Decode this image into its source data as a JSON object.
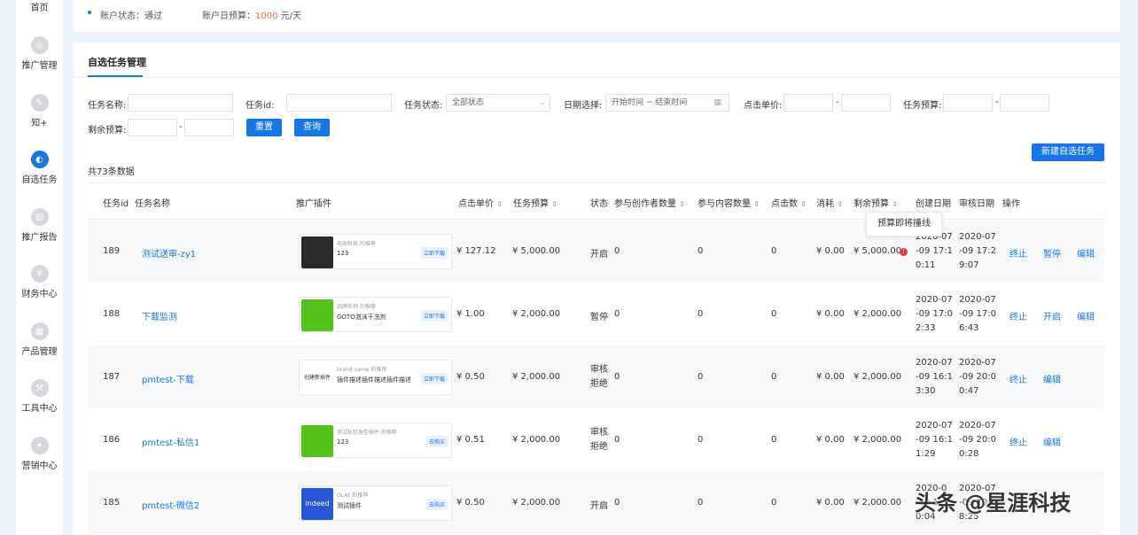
{
  "sidebar": {
    "items": [
      {
        "label": "首页",
        "icon": "home-icon"
      },
      {
        "label": "推广管理",
        "icon": "promotion-icon"
      },
      {
        "label": "知+",
        "icon": "pen-icon"
      },
      {
        "label": "自选任务",
        "icon": "task-icon"
      },
      {
        "label": "推广报告",
        "icon": "report-icon"
      },
      {
        "label": "财务中心",
        "icon": "yen-icon"
      },
      {
        "label": "产品管理",
        "icon": "product-icon"
      },
      {
        "label": "工具中心",
        "icon": "tool-icon"
      },
      {
        "label": "营销中心",
        "icon": "marketing-icon"
      }
    ]
  },
  "account": {
    "status_label": "账户状态：通过",
    "daily_budget_label": "账户日预算：",
    "daily_budget_value": "1000",
    "daily_budget_unit": " 元/天"
  },
  "tab": {
    "label": "自选任务管理"
  },
  "filters": {
    "task_name_label": "任务名称:",
    "task_id_label": "任务id:",
    "task_status_label": "任务状态:",
    "task_status_value": "全部状态",
    "date_label": "日期选择:",
    "date_placeholder": "开始时间 ~ 结束时间",
    "unit_price_label": "点击单价:",
    "budget_label": "任务预算:",
    "remaining_label": "剩余预算:",
    "dash": "-",
    "reset": "重置",
    "query": "查询",
    "new_task": "新建自选任务"
  },
  "count": "共73条数据",
  "table": {
    "headers": {
      "id": "任务id",
      "name": "任务名称",
      "plugin": "推广插件",
      "price": "点击单价",
      "budget": "任务预算",
      "status": "状态",
      "creators": "参与创作者数量",
      "contents": "参与内容数量",
      "clicks": "点击数",
      "cost": "消耗",
      "remaining": "剩余预算",
      "created": "创建日期",
      "reviewed": "审核日期",
      "ops": "操作"
    },
    "tooltip": "预算即将撞线",
    "rows": [
      {
        "id": "189",
        "name": "测试送审-zy1",
        "plugin_src": "电商科技 的推荐",
        "plugin_title": "123",
        "plugin_btn": "立即下载",
        "price": "¥ 127.12",
        "budget": "¥ 5,000.00",
        "status": "开启",
        "creators": "0",
        "contents": "0",
        "clicks": "0",
        "cost": "¥ 0.00",
        "remaining": "¥ 5,000.00",
        "created": "2020-07 -09 17:1 0:11",
        "reviewed": "2020-07 -09 17:2 9:07",
        "op1": "终止",
        "op2": "暂停",
        "op3": "编辑"
      },
      {
        "id": "188",
        "name": "下载监测",
        "plugin_src": "品牌名称 的推荐",
        "plugin_title": "GOTO泡沫干洗剂",
        "plugin_btn": "立即下载",
        "price": "¥ 1.00",
        "budget": "¥ 2,000.00",
        "status": "暂停",
        "creators": "0",
        "contents": "0",
        "clicks": "0",
        "cost": "¥ 0.00",
        "remaining": "¥ 2,000.00",
        "created": "2020-07 -09 17:0 2:33",
        "reviewed": "2020-07 -09 17:0 6:43",
        "op1": "终止",
        "op2": "开启",
        "op3": "编辑"
      },
      {
        "id": "187",
        "name": "pmtest-下载",
        "plugin_src": "brand name 的推荐",
        "plugin_title": "插件描述插件描述插件描述",
        "plugin_thumb_text": "创建新插件",
        "plugin_btn": "立即下载",
        "price": "¥ 0.50",
        "budget": "¥ 2,000.00",
        "status": "审核 拒绝",
        "creators": "0",
        "contents": "0",
        "clicks": "0",
        "cost": "¥ 0.00",
        "remaining": "¥ 2,000.00",
        "created": "2020-07 -09 16:1 3:30",
        "reviewed": "2020-07 -09 20:0 0:47",
        "op1": "终止",
        "op2": "编辑",
        "op3": ""
      },
      {
        "id": "186",
        "name": "pmtest-私信1",
        "plugin_src": "测试私信类型插件 的推荐",
        "plugin_title": "123",
        "plugin_btn": "去购买",
        "price": "¥ 0.51",
        "budget": "¥ 2,000.00",
        "status": "审核 拒绝",
        "creators": "0",
        "contents": "0",
        "clicks": "0",
        "cost": "¥ 0.00",
        "remaining": "¥ 2,000.00",
        "created": "2020-07 -09 16:1 1:29",
        "reviewed": "2020-07 -09 20:0 0:28",
        "op1": "终止",
        "op2": "编辑",
        "op3": ""
      },
      {
        "id": "185",
        "name": "pmtest-微信2",
        "plugin_src": "OLAY 的推荐",
        "plugin_title": "测试插件",
        "plugin_thumb_text": "indeed",
        "plugin_btn": "去购买",
        "price": "¥ 0.50",
        "budget": "¥ 2,000.00",
        "status": "开启",
        "creators": "0",
        "contents": "0",
        "clicks": "0",
        "cost": "¥ 0.00",
        "remaining": "¥ 2,000.00",
        "created": "2020-0 -09 1 0:04",
        "reviewed": "2020-07 -09 20:0 8:25",
        "op1": "",
        "op2": "",
        "op3": ""
      }
    ]
  },
  "watermark": "头条 @星涯科技",
  "colors": {
    "accent": "#1677e8",
    "budget": "#f26b3a",
    "warning": "#e83a3a"
  }
}
